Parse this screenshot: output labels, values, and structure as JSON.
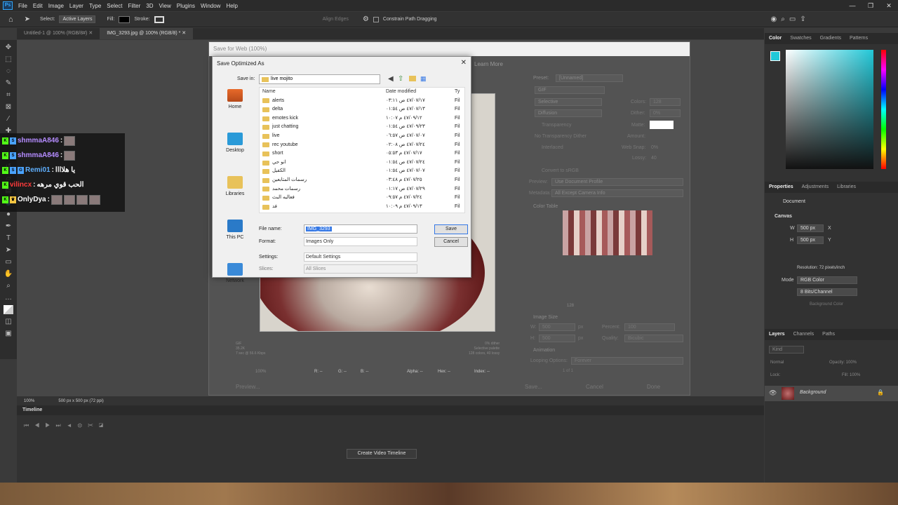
{
  "menubar": {
    "items": [
      "File",
      "Edit",
      "Image",
      "Layer",
      "Type",
      "Select",
      "Filter",
      "3D",
      "View",
      "Plugins",
      "Window",
      "Help"
    ]
  },
  "optionsbar": {
    "select_label": "Select:",
    "select_value": "Active Layers",
    "fill_label": "Fill:",
    "stroke_label": "Stroke:",
    "align_edges": "Align Edges",
    "constrain": "Constrain Path Dragging"
  },
  "tabs": [
    {
      "label": "Untitled-1 @ 100% (RGB/8#)"
    },
    {
      "label": "IMG_3293.jpg @ 100% (RGB/8) *"
    }
  ],
  "statusbar": {
    "zoom": "100%",
    "size": "500 px x 500 px (72 ppi)"
  },
  "timeline": {
    "title": "Timeline",
    "create_button": "Create Video Timeline"
  },
  "right": {
    "color_tabs": [
      "Color",
      "Swatches",
      "Gradients",
      "Patterns"
    ],
    "props_tabs": [
      "Properties",
      "Adjustments",
      "Libraries"
    ],
    "document": "Document",
    "canvas": "Canvas",
    "w_value": "500 px",
    "h_value": "500 px",
    "w_label": "W",
    "h_label": "H",
    "x_label": "X",
    "y_label": "Y",
    "resolution": "Resolution: 72 pixels/inch",
    "mode_label": "Mode",
    "mode_value": "RGB Color",
    "bits": "8 Bits/Channel",
    "bg_color": "Background Color",
    "layers_tabs": [
      "Layers",
      "Channels",
      "Paths"
    ],
    "layer_kind": "Kind",
    "layer_mode": "Normal",
    "opacity": "Opacity: 100%",
    "lock": "Lock:",
    "fill": "Fill: 100%",
    "layer_name": "Background"
  },
  "sfw": {
    "title": "Save for Web (100%)",
    "learn_more": "Learn More",
    "preset_label": "Preset:",
    "preset_value": "[Unnamed]",
    "format_value": "GIF",
    "selective": "Selective",
    "diffusion": "Diffusion",
    "colors_label": "Colors:",
    "colors_value": "128",
    "dither_label": "Dither:",
    "dither_value": "0%",
    "transparency": "Transparency",
    "matte_label": "Matte:",
    "no_trans_dither": "No Transparency Dither",
    "amount_label": "Amount:",
    "interlaced": "Interlaced",
    "websnap_label": "Web Snap:",
    "websnap_value": "0%",
    "lossy_label": "Lossy:",
    "lossy_value": "40",
    "convert_srgb": "Convert to sRGB",
    "preview_label": "Preview:",
    "preview_value": "Use Document Profile",
    "metadata_label": "Metadata:",
    "metadata_value": "All Except Camera Info",
    "color_table": "Color Table",
    "palette_count": "128",
    "image_size": "Image Size",
    "w_label": "W:",
    "w_value": "500",
    "h_label": "H:",
    "h_value": "500",
    "px": "px",
    "percent_label": "Percent:",
    "percent_value": "100",
    "quality_label": "Quality:",
    "quality_value": "Bicubic",
    "animation": "Animation",
    "looping_label": "Looping Options:",
    "looping_value": "Forever",
    "frame": "1 of 1",
    "gif_info": "GIF\n35.2K\n7 sec @ 56.6 Kbps",
    "dither_info": "0% dither\nSelective palette\n128 colors, 40 lossy",
    "zoom": "100%",
    "r": "R: --",
    "g": "G: --",
    "b": "B: --",
    "alpha": "Alpha: --",
    "hex": "Hex: --",
    "index": "Index: --",
    "preview_btn": "Preview...",
    "save_btn": "Save...",
    "cancel_btn": "Cancel",
    "done_btn": "Done"
  },
  "dialog": {
    "title": "Save Optimized As",
    "save_in_label": "Save in:",
    "save_in_value": "live mojito",
    "places": [
      "Home",
      "Desktop",
      "Libraries",
      "This PC",
      "Network"
    ],
    "col_name": "Name",
    "col_date": "Date modified",
    "col_type": "Ty",
    "files": [
      {
        "name": "alerts",
        "date": "٤٧/٠٧/١٧ ص ٠٣:١١",
        "type": "Fil"
      },
      {
        "name": "delta",
        "date": "٤٧/٠٧/١٣ ص ٠١:٥٤",
        "type": "Fil"
      },
      {
        "name": "emotes kick",
        "date": "٤٧/٠٩/١٢ م ١٠:٠٧",
        "type": "Fil"
      },
      {
        "name": "just chatting",
        "date": "٤٧/٠٩/٢٣ ص ٠١:٥٤",
        "type": "Fil"
      },
      {
        "name": "live",
        "date": "٤٧/٠٧/٠٧ ص ٠٦:٥٧",
        "type": "Fil"
      },
      {
        "name": "rec youtube",
        "date": "٤٧/٠٧/٢٤ ص ٠٢:٠٨",
        "type": "Fil"
      },
      {
        "name": "short",
        "date": "٤٧/٠٧/١٧ م ٠٥:٥٣",
        "type": "Fil"
      },
      {
        "name": "انو حي",
        "date": "٤٧/٠٧/٢٤ ص ٠١:٥٤",
        "type": "Fil"
      },
      {
        "name": "الكفيل",
        "date": "٤٧/٠٧/٠٧ ص ٠١:٥٤",
        "type": "Fil"
      },
      {
        "name": "رسمات المتابعين",
        "date": "٤٧/٠٧/٢٥ م ٠٣:٤٨",
        "type": "Fil"
      },
      {
        "name": "رسمات محمد",
        "date": "٤٧/٠٧/٢٩ ص ٠١:١٧",
        "type": "Fil"
      },
      {
        "name": "فعاليه البث",
        "date": "٤٧/٠٧/٢٤ م ٠٩:٥٧",
        "type": "Fil"
      },
      {
        "name": "فد",
        "date": "٤٧/٠٩/١٣ م ١٠:٠٩",
        "type": "Fil"
      }
    ],
    "filename_label": "File name:",
    "filename_value": "IMG_3293",
    "format_label": "Format:",
    "format_value": "Images Only",
    "settings_label": "Settings:",
    "settings_value": "Default Settings",
    "slices_label": "Slices:",
    "slices_value": "All Slices",
    "save_btn": "Save",
    "cancel_btn": "Cancel"
  },
  "chat": [
    {
      "user": "shmmaA846",
      "user_color": "#b58cff",
      "sep": ":",
      "text": ""
    },
    {
      "user": "shmmaA846",
      "user_color": "#b58cff",
      "sep": ":",
      "text": ""
    },
    {
      "user": "Remi01",
      "user_color": "#5fb0ff",
      "sep": ":",
      "text": "يا هلاااا"
    },
    {
      "user": "vilincx",
      "user_color": "#ff3b3b",
      "sep": ":",
      "text": "الحب قوي مرهه"
    },
    {
      "user": "OnlyDya",
      "user_color": "#ffffff",
      "sep": ":",
      "text": ""
    }
  ]
}
